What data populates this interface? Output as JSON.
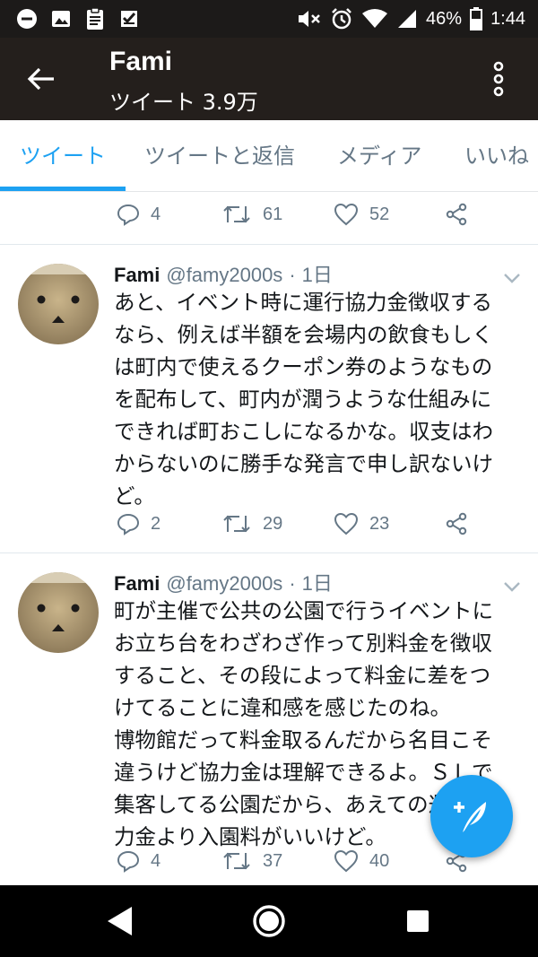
{
  "status_bar": {
    "battery": "46%",
    "time": "1:44",
    "icons": [
      "dnd-icon",
      "image-icon",
      "clipboard-icon",
      "check-app-icon",
      "mute-icon",
      "alarm-icon",
      "wifi-icon",
      "signal-icon",
      "battery-icon"
    ]
  },
  "header": {
    "title": "Fami",
    "subtitle": "ツイート 3.9万"
  },
  "tabs": [
    {
      "label": "ツイート",
      "active": true
    },
    {
      "label": "ツイートと返信",
      "active": false
    },
    {
      "label": "メディア",
      "active": false
    },
    {
      "label": "いいね",
      "active": false
    }
  ],
  "top_actions": {
    "replies": "4",
    "retweets": "61",
    "likes": "52"
  },
  "tweets": [
    {
      "name": "Fami",
      "handle": "@famy2000s",
      "dot": "·",
      "time": "1日",
      "lines": [
        "あと、イベント時に運行協力金徴収する",
        "なら、例えば半額を会場内の飲食もしく",
        "は町内で使えるクーポン券のようなもの",
        "を配布して、町内が潤うような仕組みに",
        "できれば町おこしになるかな。収支はわ",
        "からないのに勝手な発言で申し訳ないけ",
        "ど。"
      ],
      "replies": "2",
      "retweets": "29",
      "likes": "23"
    },
    {
      "name": "Fami",
      "handle": "@famy2000s",
      "dot": "·",
      "time": "1日",
      "lines": [
        "町が主催で公共の公園で行うイベントに",
        "お立ち台をわざわざ作って別料金を徴収",
        "すること、その段によって料金に差をつ",
        "けてることに違和感を感じたのね。",
        "博物館だって料金取るんだから名目こそ",
        "違うけど協力金は理解できるよ。ＳＬで",
        "集客してる公園だから、あえての運行協",
        "力金より入園料がいいけど。"
      ],
      "replies": "4",
      "retweets": "37",
      "likes": "40"
    }
  ],
  "colors": {
    "accent": "#1da1f2",
    "header_bg": "#241f1c",
    "status_bg": "#1c1a19",
    "muted": "#657786",
    "text": "#14171a"
  }
}
